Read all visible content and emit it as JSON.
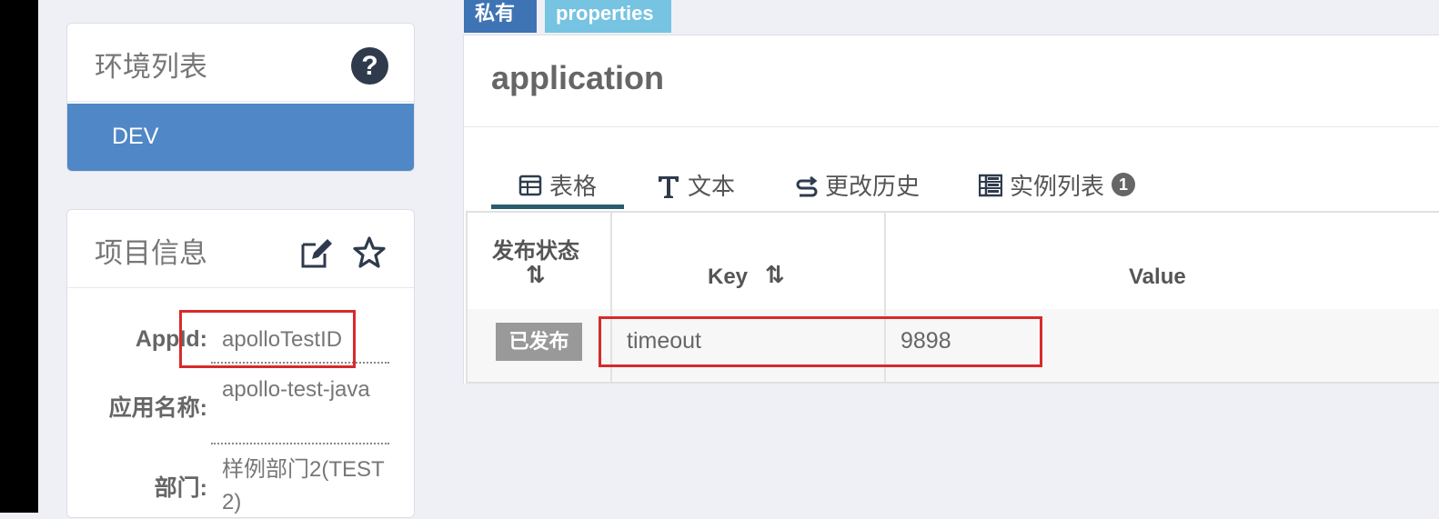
{
  "env_panel": {
    "title": "环境列表",
    "help_glyph": "?",
    "items": [
      {
        "label": "DEV",
        "selected": true
      }
    ]
  },
  "project_panel": {
    "title": "项目信息",
    "fields": [
      {
        "label": "AppId:",
        "value": "apolloTestID"
      },
      {
        "label": "应用名称:",
        "value": "apollo-test-java"
      },
      {
        "label": "部门:",
        "value": "样例部门2(TEST2)"
      }
    ]
  },
  "namespace": {
    "tags": {
      "private": "私有",
      "format": "properties"
    },
    "title": "application",
    "tabs": [
      {
        "label": "表格",
        "icon": "table-icon",
        "active": true
      },
      {
        "label": "文本",
        "icon": "text-icon"
      },
      {
        "label": "更改历史",
        "icon": "history-icon"
      },
      {
        "label": "实例列表",
        "icon": "instances-icon",
        "badge": "1"
      }
    ],
    "table": {
      "headers": {
        "status": "发布状态",
        "key": "Key",
        "value": "Value"
      },
      "rows": [
        {
          "status": "已发布",
          "key": "timeout",
          "value": "9898"
        }
      ]
    }
  },
  "colors": {
    "accent": "#5087c6",
    "highlight": "#d82a2a",
    "tag_private": "#3e74b4",
    "tag_format": "#76c3e2"
  }
}
